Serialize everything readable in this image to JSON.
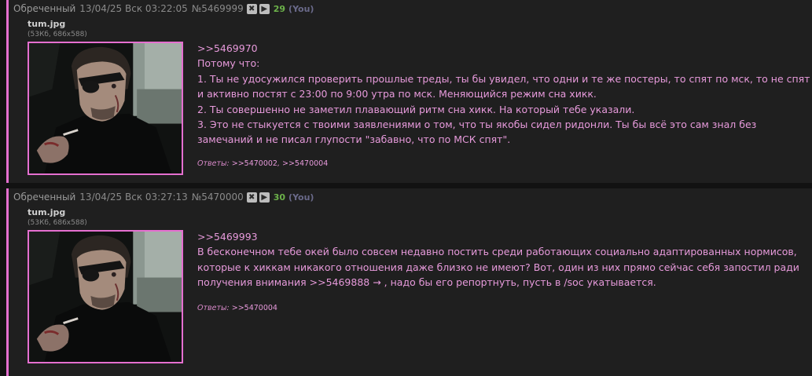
{
  "posts": [
    {
      "name": "Обреченный",
      "date": "13/04/25 Вск 03:22:05",
      "number": "№5469999",
      "delete_icon": "✖",
      "play_icon": "▶",
      "likes": "29",
      "you_label": "(You)",
      "file": {
        "name": "tum.jpg",
        "meta": "(53Кб, 686x588)"
      },
      "reply_to": ">>5469970",
      "lines": [
        "Потому что:",
        "1. Ты не удосужился проверить прошлые треды, ты бы увидел, что одни и те же постеры, то спят по мск, то не спят и активно постят с 23:00 по 9:00 утра по мск. Меняющийся режим сна хикк.",
        "2. Ты совершенно не заметил плавающий ритм сна хикк. На который тебе указали.",
        "3. Это не стыкуется с твоими заявлениями о том, что ты якобы сидел ридонли. Ты бы всё это сам знал без замечаний и не писал глупости \"забавно, что по МСК спят\"."
      ],
      "answers_label": "Ответы:",
      "answers": [
        ">>5470002",
        ">>5470004"
      ]
    },
    {
      "name": "Обреченный",
      "date": "13/04/25 Вск 03:27:13",
      "number": "№5470000",
      "delete_icon": "✖",
      "play_icon": "▶",
      "likes": "30",
      "you_label": "(You)",
      "file": {
        "name": "tum.jpg",
        "meta": "(53Кб, 686x588)"
      },
      "reply_to": ">>5469993",
      "text_before": "В бесконечном тебе окей было совсем недавно постить среди работающих социально адаптированных нормисов, которые к хиккам никакого отношения даже близко не имеют? Вот, один из них прямо сейчас себя запостил ради получения внимания ",
      "inline_link": ">>5469888 →",
      "text_after": " , надо бы его репортнуть, пусть в /soc укатывается.",
      "answers_label": "Ответы:",
      "answers": [
        ">>5470004"
      ]
    }
  ]
}
